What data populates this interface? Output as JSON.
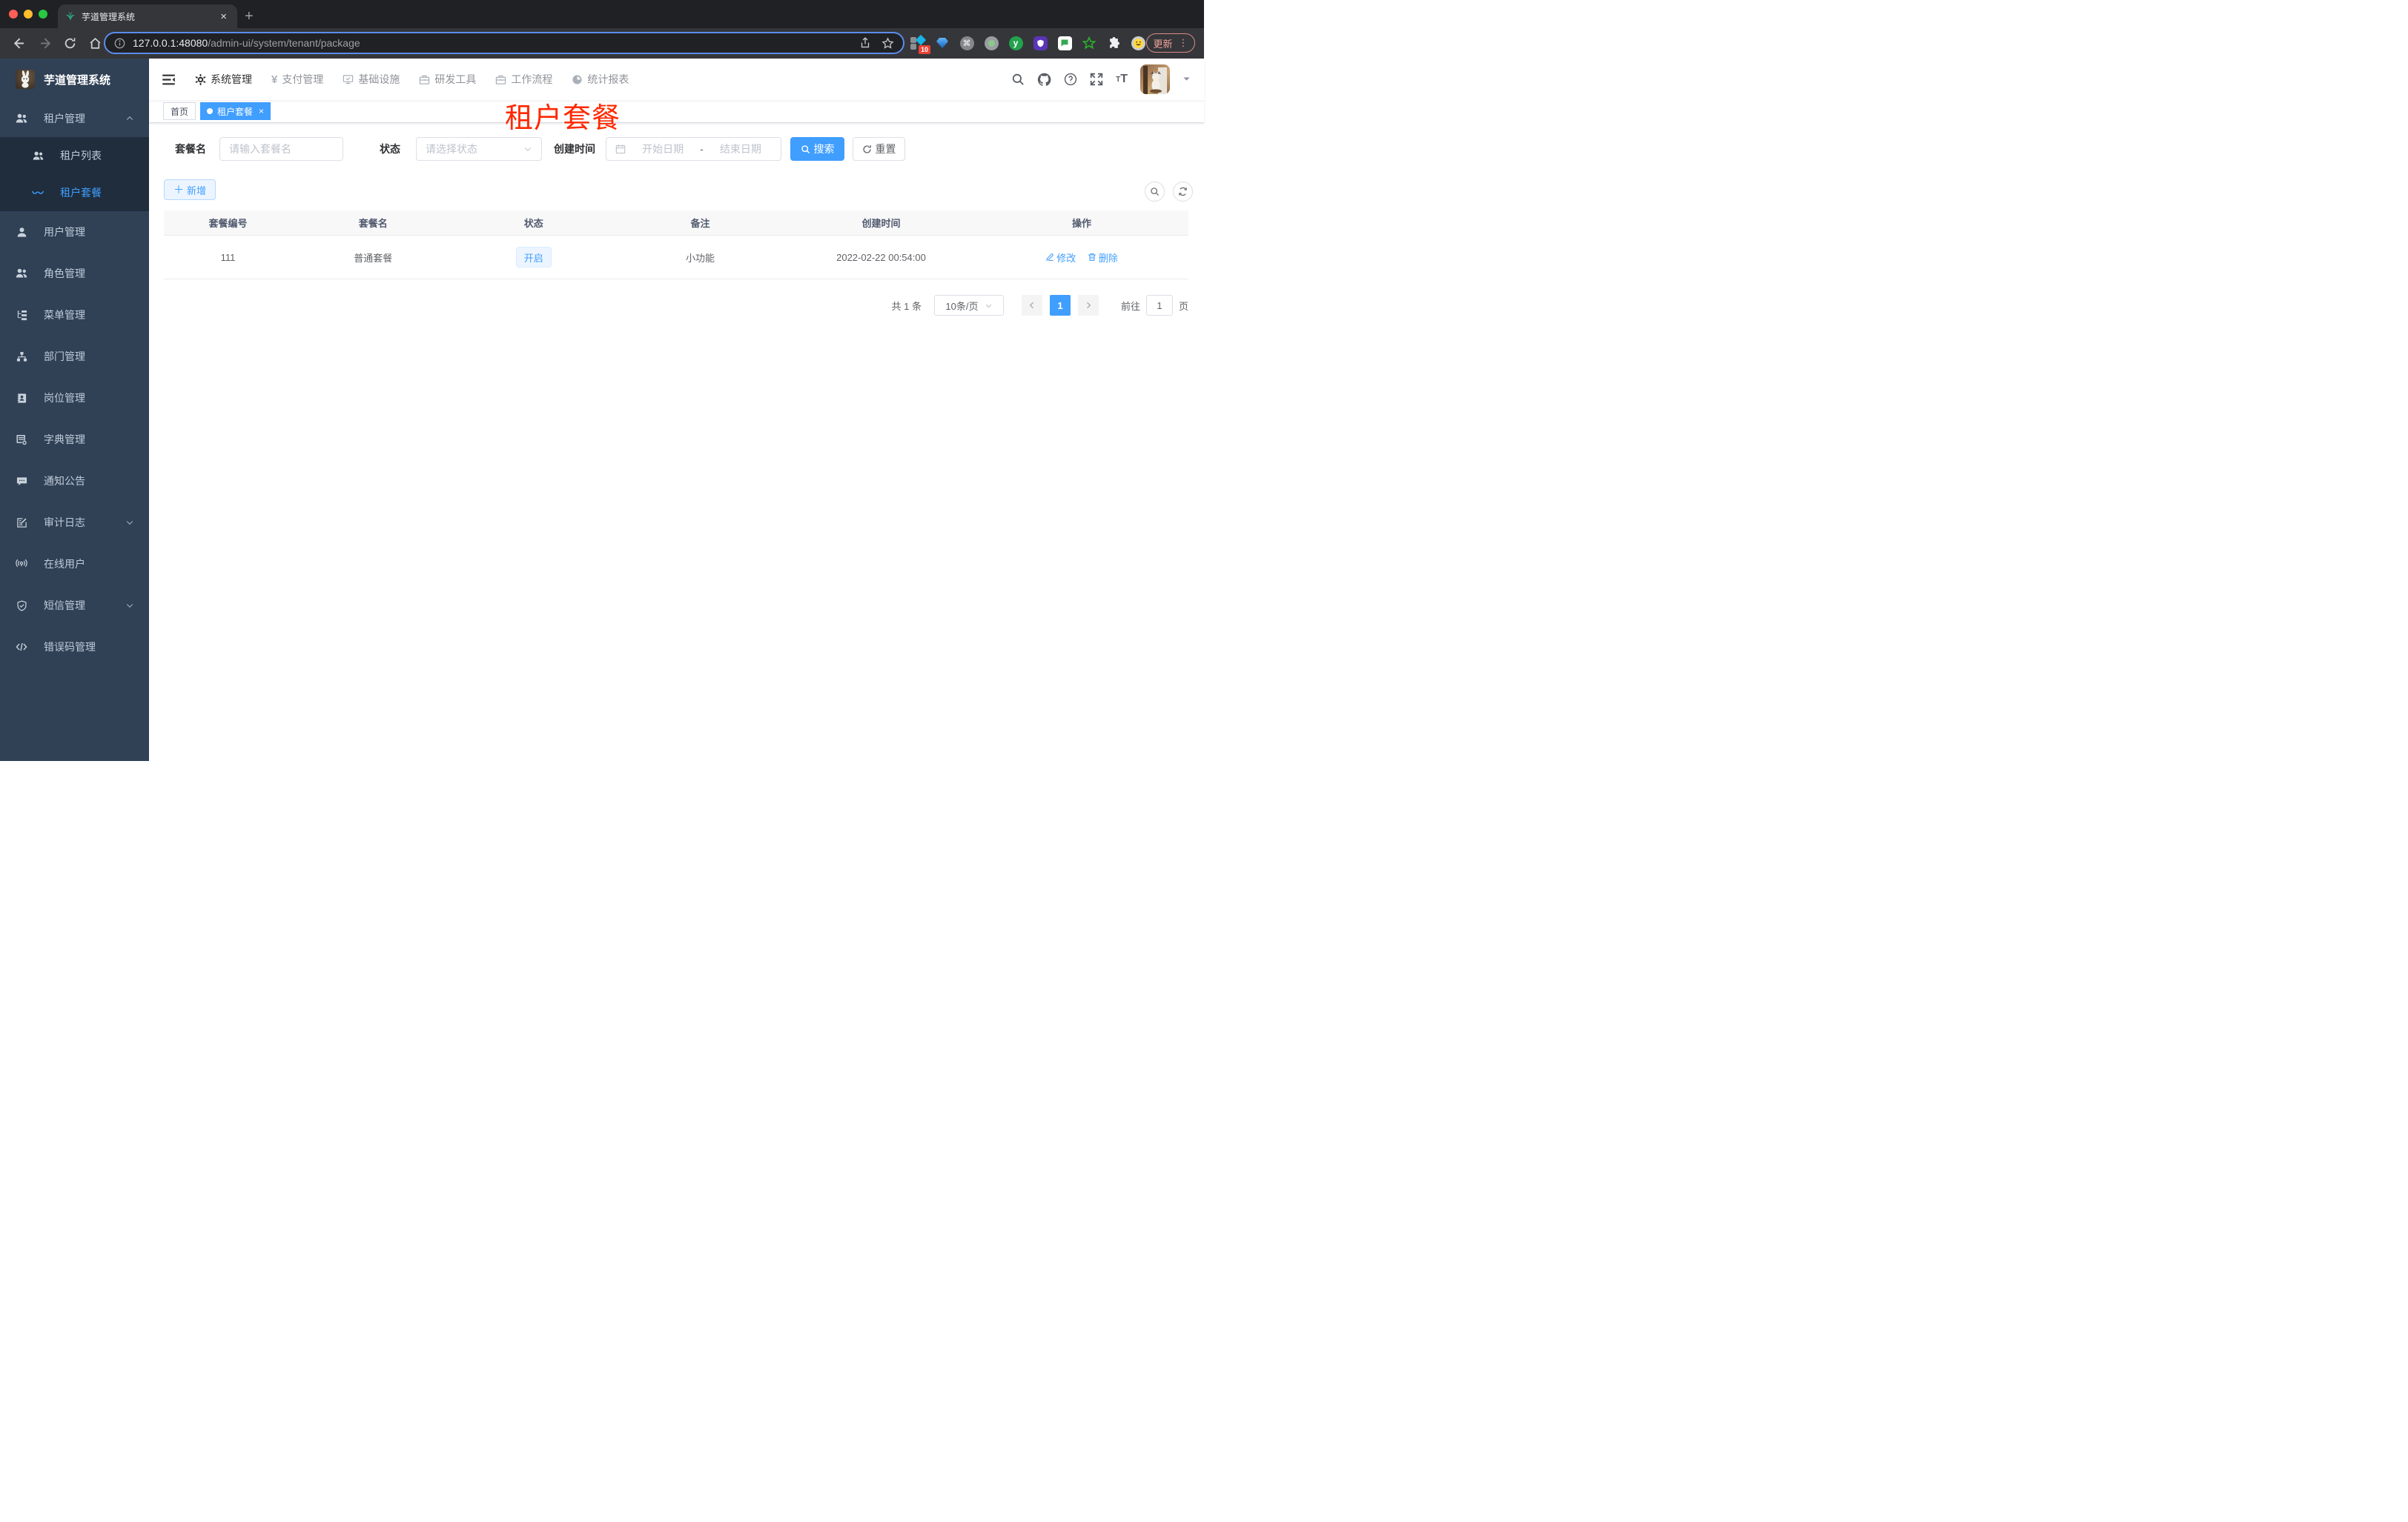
{
  "theme": {
    "accent": "#409eff",
    "sidebar_bg": "#304156",
    "submenu_bg": "#1f2d3d",
    "annotation_color": "#ff2800",
    "status_tag_bg": "#ecf5ff"
  },
  "browser": {
    "tab_title": "芋道管理系统",
    "tab_close": "×",
    "new_tab": "+",
    "url_host": "127.0.0.1:48080",
    "url_path": "/admin-ui/system/tenant/package",
    "extension_badge": "10",
    "update_label": "更新",
    "menu_dots": "⋮"
  },
  "sidebar": {
    "logo_title": "芋道管理系统",
    "items": [
      {
        "label": "租户管理"
      },
      {
        "label": "租户列表"
      },
      {
        "label": "租户套餐"
      },
      {
        "label": "用户管理"
      },
      {
        "label": "角色管理"
      },
      {
        "label": "菜单管理"
      },
      {
        "label": "部门管理"
      },
      {
        "label": "岗位管理"
      },
      {
        "label": "字典管理"
      },
      {
        "label": "通知公告"
      },
      {
        "label": "审计日志"
      },
      {
        "label": "在线用户"
      },
      {
        "label": "短信管理"
      },
      {
        "label": "错误码管理"
      }
    ]
  },
  "topnav": {
    "items": [
      {
        "label": "系统管理"
      },
      {
        "label": "支付管理"
      },
      {
        "label": "基础设施"
      },
      {
        "label": "研发工具"
      },
      {
        "label": "工作流程"
      },
      {
        "label": "统计报表"
      }
    ]
  },
  "tags": {
    "home": "首页",
    "active": "租户套餐",
    "close": "×"
  },
  "annotation": {
    "text": "租户套餐"
  },
  "filters": {
    "name_label": "套餐名",
    "name_placeholder": "请输入套餐名",
    "status_label": "状态",
    "status_placeholder": "请选择状态",
    "date_label": "创建时间",
    "date_start_placeholder": "开始日期",
    "date_separator": "-",
    "date_end_placeholder": "结束日期",
    "search_label": "搜索",
    "reset_label": "重置"
  },
  "toolbar": {
    "add_label": "新增"
  },
  "table": {
    "columns": [
      "套餐编号",
      "套餐名",
      "状态",
      "备注",
      "创建时间",
      "操作"
    ],
    "rows": [
      {
        "id": "111",
        "name": "普通套餐",
        "status": "开启",
        "remark": "小功能",
        "created": "2022-02-22 00:54:00",
        "edit_label": "修改",
        "delete_label": "删除"
      }
    ]
  },
  "pagination": {
    "total": "共 1 条",
    "page_size": "10条/页",
    "current_page": "1",
    "goto_label": "前往",
    "goto_value": "1",
    "unit_label": "页"
  }
}
